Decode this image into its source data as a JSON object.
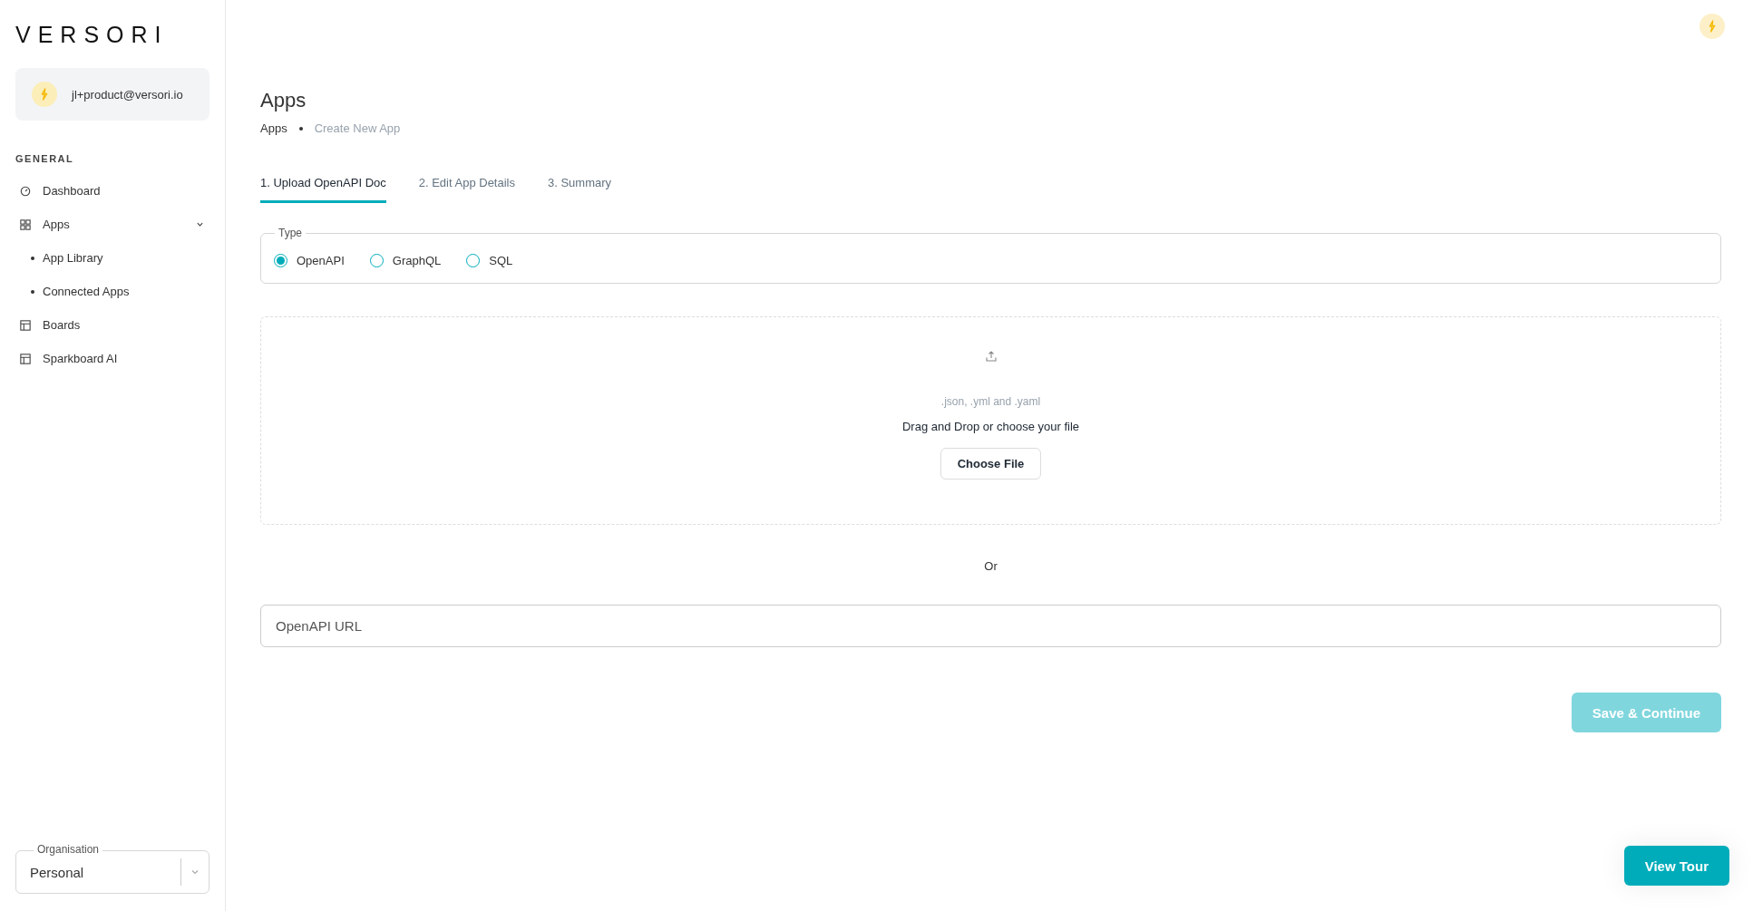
{
  "sidebar": {
    "logo": "VERSORI",
    "user": {
      "email": "jl+product@versori.io"
    },
    "section": "GENERAL",
    "items": [
      {
        "kind": "link",
        "label": "Dashboard"
      },
      {
        "kind": "group",
        "label": "Apps",
        "expanded": true,
        "children": [
          {
            "label": "App Library"
          },
          {
            "label": "Connected Apps"
          }
        ]
      },
      {
        "kind": "link",
        "label": "Boards"
      },
      {
        "kind": "link",
        "label": "Sparkboard AI"
      }
    ],
    "organisation": {
      "label": "Organisation",
      "value": "Personal"
    }
  },
  "page": {
    "title": "Apps",
    "breadcrumb": [
      {
        "label": "Apps",
        "current": false
      },
      {
        "label": "Create New App",
        "current": true
      }
    ],
    "tabs": [
      {
        "label": "1. Upload OpenAPI Doc",
        "selected": true
      },
      {
        "label": "2. Edit App Details",
        "selected": false
      },
      {
        "label": "3. Summary",
        "selected": false
      }
    ],
    "type": {
      "legend": "Type",
      "options": [
        {
          "label": "OpenAPI",
          "selected": true
        },
        {
          "label": "GraphQL",
          "selected": false
        },
        {
          "label": "SQL",
          "selected": false
        }
      ]
    },
    "upload": {
      "formats": ".json, .yml and .yaml",
      "prompt": "Drag and Drop or choose your file",
      "button": "Choose File"
    },
    "separator": "Or",
    "url_field": {
      "placeholder": "OpenAPI URL"
    },
    "save_button": {
      "label": "Save & Continue",
      "disabled": true
    },
    "tour_button": {
      "label": "View Tour"
    }
  }
}
